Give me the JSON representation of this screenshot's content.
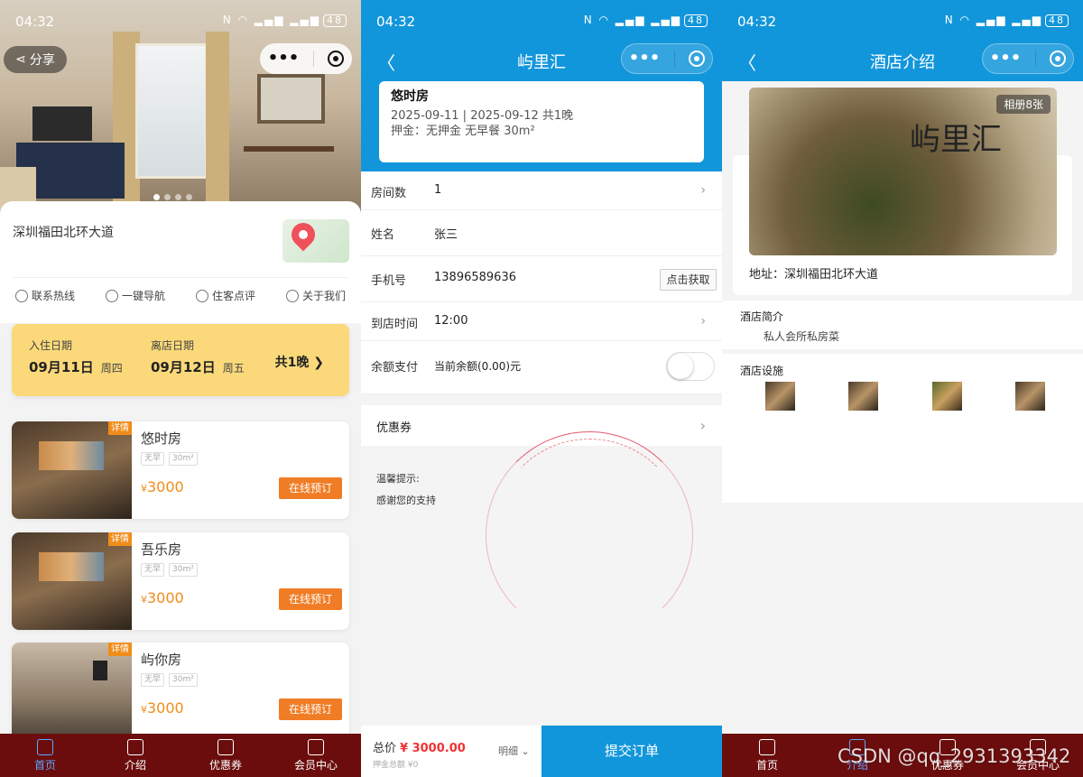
{
  "status": {
    "time": "04:32",
    "battery": "48"
  },
  "screen1": {
    "share_label": "分享",
    "address": "深圳福田北环大道",
    "quick_links": [
      "联系热线",
      "一键导航",
      "住客点评",
      "关于我们"
    ],
    "checkin_label": "入住日期",
    "checkin_date": "09月11日",
    "checkin_weekday": "周四",
    "checkout_label": "离店日期",
    "checkout_date": "09月12日",
    "checkout_weekday": "周五",
    "nights": "共1晚",
    "rooms": [
      {
        "name": "悠时房",
        "tag": "详情",
        "features": [
          "无早",
          "30m²"
        ],
        "currency": "¥",
        "price": "3000",
        "book_label": "在线预订"
      },
      {
        "name": "吾乐房",
        "tag": "详情",
        "features": [
          "无早",
          "30m²"
        ],
        "currency": "¥",
        "price": "3000",
        "book_label": "在线预订"
      },
      {
        "name": "屿你房",
        "tag": "详情",
        "features": [
          "无早",
          "30m²"
        ],
        "currency": "¥",
        "price": "3000",
        "book_label": "在线预订"
      }
    ],
    "tabs": [
      "首页",
      "介绍",
      "优惠券",
      "会员中心"
    ],
    "active_tab": "首页"
  },
  "screen2": {
    "title": "屿里汇",
    "room_name": "悠时房",
    "stay_line": "2025-09-11 | 2025-09-12 共1晚",
    "deposit_line": "押金：无押金 无早餐 30m²",
    "fields": {
      "rooms_label": "房间数",
      "rooms_value": "1",
      "name_label": "姓名",
      "name_value": "张三",
      "phone_label": "手机号",
      "phone_value": "13896589636",
      "get_code_label": "点击获取",
      "arrival_label": "到店时间",
      "arrival_value": "12:00",
      "balance_label": "余额支付",
      "balance_value": "当前余额(0.00)元"
    },
    "coupon_label": "优惠券",
    "tips_title": "温馨提示:",
    "tips_text": "感谢您的支持",
    "total_label": "总价",
    "total_value": "¥ 3000.00",
    "deposit_total": "押金总额 ¥0",
    "detail_label": "明细",
    "submit_label": "提交订单"
  },
  "screen3": {
    "title": "酒店介绍",
    "album_label": "相册8张",
    "logo_text": "屿里汇",
    "address": "地址：深圳福田北环大道",
    "intro_title": "酒店简介",
    "intro_text": "私人会所私房菜",
    "facilities_title": "酒店设施",
    "tabs": [
      "首页",
      "介绍",
      "优惠券",
      "会员中心"
    ],
    "active_tab": "介绍"
  },
  "watermark": "CSDN @qq_2931393342",
  "colors": {
    "primary_blue": "#1296db",
    "tab_bg": "#6b0d0d",
    "accent_orange": "#f07d26",
    "date_bar": "#fbd97a"
  }
}
